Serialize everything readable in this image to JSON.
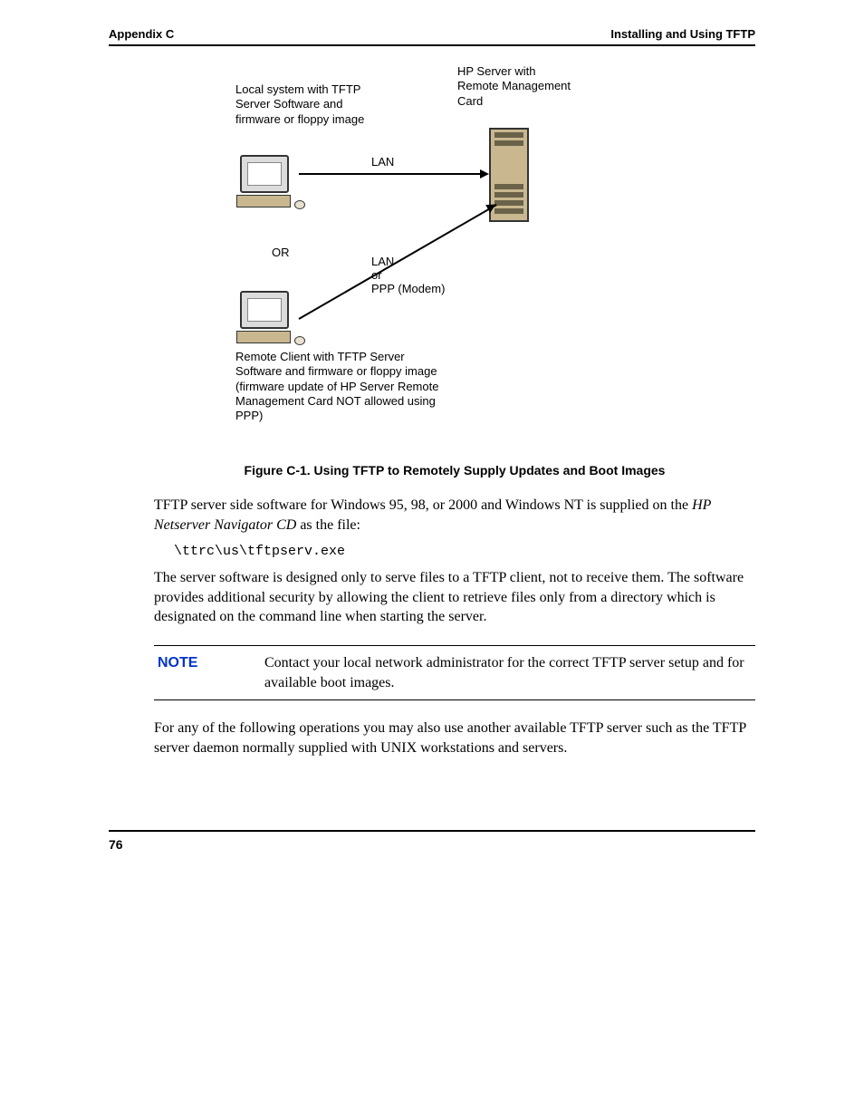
{
  "header": {
    "left": "Appendix C",
    "right": "Installing and Using TFTP"
  },
  "diagram": {
    "local_label": "Local system with TFTP Server Software and firmware or floppy image",
    "server_label": "HP Server with Remote Management Card",
    "lan1": "LAN",
    "or": "OR",
    "lan2": "LAN",
    "or_ppp": "or",
    "ppp": "PPP (Modem)",
    "remote_label": "Remote Client with TFTP Server Software and firmware or floppy image (firmware update of HP Server Remote Management Card NOT allowed using PPP)"
  },
  "figure_caption": "Figure C-1.  Using TFTP to Remotely Supply Updates and Boot Images",
  "para1_a": "TFTP server side software for Windows 95, 98, or 2000 and Windows NT is supplied on the ",
  "para1_italic": "HP Netserver Navigator CD",
  "para1_b": " as the file:",
  "code_path": "\\ttrc\\us\\tftpserv.exe",
  "para2": "The server software is designed only to serve files to a TFTP client, not to receive them. The software provides additional security by allowing the client to retrieve files only from a directory which is designated on the command line when starting the server.",
  "note": {
    "label": "NOTE",
    "text": "Contact your local network administrator for the correct TFTP server setup and for available boot images."
  },
  "para3": "For any of the following operations you may also use another available TFTP server such as the TFTP server daemon normally supplied with UNIX workstations and servers.",
  "page_number": "76"
}
